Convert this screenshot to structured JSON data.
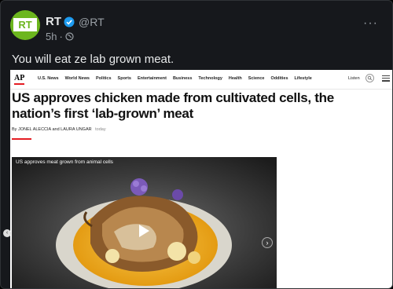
{
  "tweet": {
    "account_name": "RT",
    "handle": "@RT",
    "time_ago": "5h",
    "separator": "·",
    "text": "You will eat ze lab grown meat.",
    "more_icon": "more-horizontal-icon",
    "verified_icon": "verified-badge-icon",
    "avatar_logo": "RT",
    "avatar_color": "#6cb61e"
  },
  "article": {
    "logo": "AP",
    "nav_items": [
      "U.S. News",
      "World News",
      "Politics",
      "Sports",
      "Entertainment",
      "Business",
      "Technology",
      "Health",
      "Science",
      "Oddities",
      "Lifestyle"
    ],
    "listen_label": "Listen",
    "headline": "US approves chicken made from cultivated cells, the nation’s first ‘lab-grown’ meat",
    "byline": "By JONEL ALECCIA and LAURA UNGAR",
    "byline_time": "today",
    "accent_color": "#e41d23",
    "video": {
      "caption": "US approves meat grown from animal cells",
      "next_label": "›",
      "prev_label": "‹"
    }
  }
}
